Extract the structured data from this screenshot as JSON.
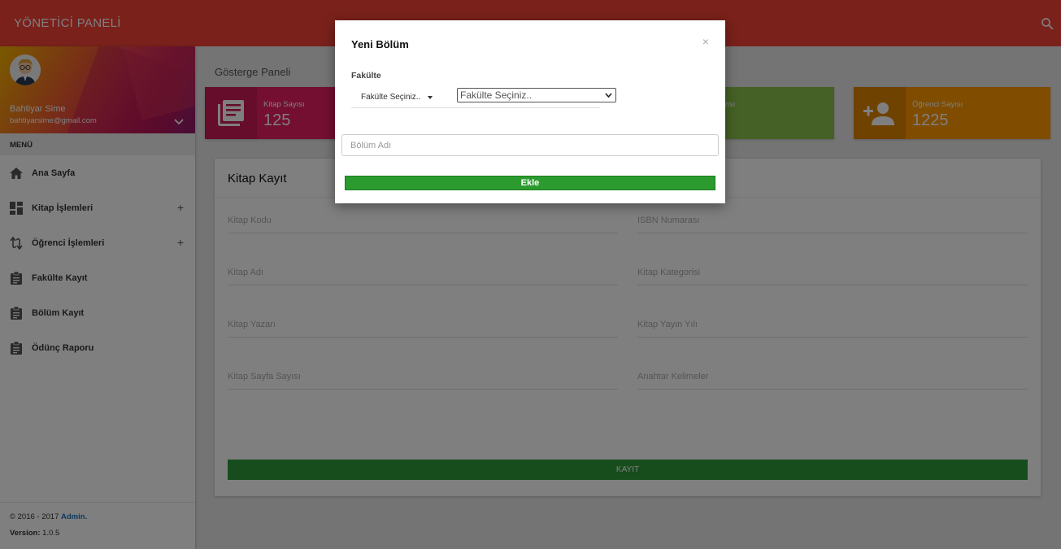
{
  "topbar": {
    "brand": "YÖNETİCİ PANELİ",
    "search_icon": "search-icon"
  },
  "user": {
    "name": "Bahtiyar Sime",
    "email": "bahtiyarsime@gmail.com"
  },
  "menu": {
    "header": "MENÜ",
    "items": [
      {
        "label": "Ana Sayfa",
        "icon": "home-icon",
        "expandable": false
      },
      {
        "label": "Kitap İşlemleri",
        "icon": "dashboard-icon",
        "expandable": true
      },
      {
        "label": "Öğrenci İşlemleri",
        "icon": "swap-icon",
        "expandable": true
      },
      {
        "label": "Fakülte Kayıt",
        "icon": "clipboard-icon",
        "expandable": false
      },
      {
        "label": "Bölüm Kayıt",
        "icon": "clipboard-icon",
        "expandable": false
      },
      {
        "label": "Ödünç Raporu",
        "icon": "clipboard-icon",
        "expandable": false
      }
    ],
    "plus": "+"
  },
  "legal": {
    "copyright": "© 2016 - 2017 ",
    "admin_link": "Admin.",
    "version_label": "Version:",
    "version": " 1.0.5"
  },
  "page": {
    "title": "Gösterge Paneli"
  },
  "stats": [
    {
      "label": "Kitap Sayısı",
      "value": "125",
      "color": "#e91e63"
    },
    {
      "label": "Sayısı",
      "value": "",
      "color": "#8bc34a"
    },
    {
      "label": "Öğrenci Sayısı",
      "value": "1225",
      "color": "#ff9800"
    }
  ],
  "form": {
    "title": "Kitap Kayıt",
    "fields": {
      "kitap_kodu": "Kitap Kodu",
      "isbn": "ISBN Numarası",
      "kitap_adi": "Kitap Adı",
      "kategori": "Kitap Kategorisi",
      "yazar": "Kitap Yazarı",
      "yayin_yili": "Kitap Yayın Yılı",
      "sayfa": "Kitap Sayfa Sayısı",
      "anahtar": "Anahtar Kelimeler"
    },
    "submit": "KAYIT"
  },
  "modal": {
    "title": "Yeni Bölüm",
    "close": "×",
    "faculty_label": "Fakülte",
    "faculty_button": "Fakülte Seçiniz..",
    "faculty_select": "Fakülte Seçiniz..",
    "bolum_placeholder": "Bölüm  Adı",
    "submit": "Ekle"
  },
  "colors": {
    "topbar": "#f44336",
    "success": "#2c9b2f"
  }
}
